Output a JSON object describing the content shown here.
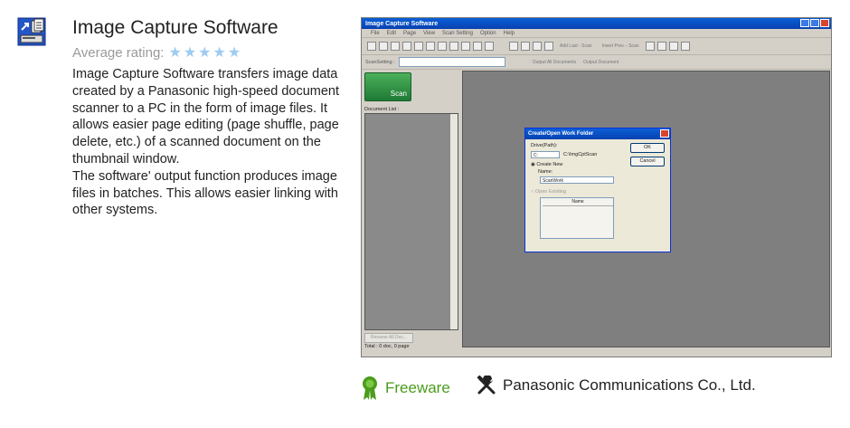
{
  "header": {
    "title": "Image Capture Software",
    "rating_label": "Average rating:",
    "rating_stars": 5
  },
  "description": [
    "Image Capture Software transfers image data created by a Panasonic high-speed document scanner to a PC in the form of image files. It allows easier page editing (page shuffle, page delete, etc.) of a scanned document on the thumbnail window.",
    "The software' output function produces image files in batches. This allows easier linking with other systems."
  ],
  "screenshot": {
    "window_title": "Image Capture Software",
    "menu": [
      "File",
      "Edit",
      "Page",
      "View",
      "Scan Setting",
      "Option",
      "Help"
    ],
    "toolbar_texts": [
      "Add Last - Scan",
      "Insert Prev. - Scan"
    ],
    "toolbar2_label": "ScanSetting :",
    "toolbar2_texts": [
      "Output All Documents",
      "Output Document"
    ],
    "scan_button": "Scan",
    "doc_list_label": "Document List :",
    "rename_button": "Rename All Doc...",
    "total_text": "Total :   0 doc,      0 page",
    "dialog": {
      "title": "Create/Open Work Folder",
      "drive_label": "Drive(Path):",
      "drive_value": "C:",
      "path_value": "C:\\ImgCptScan",
      "create_new": "Create New",
      "name_label": "Name:",
      "name_value": "ScanWork",
      "open_existing": "Open Existing",
      "list_header": "Name",
      "ok": "OK",
      "cancel": "Cancel"
    }
  },
  "footer": {
    "license": "Freeware",
    "publisher": "Panasonic Communications Co., Ltd."
  },
  "colors": {
    "license_green": "#4a9d1c",
    "star_blue": "#9ecbf0"
  }
}
